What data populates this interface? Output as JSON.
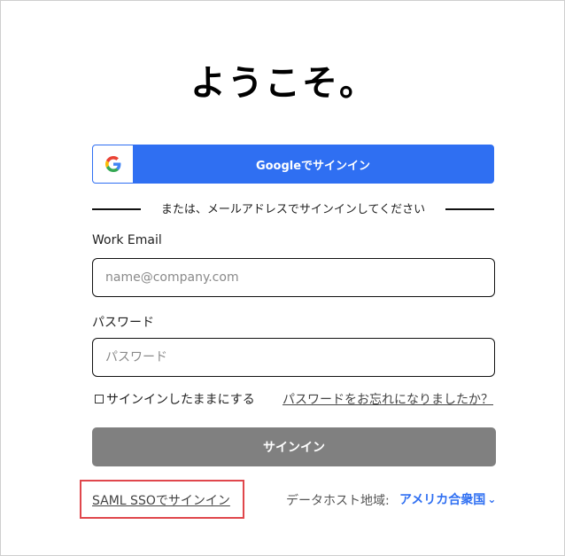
{
  "title": "ようこそ。",
  "google": {
    "button_label": "Googleでサインイン",
    "icon": "google-logo-icon"
  },
  "divider": {
    "text": "または、メールアドレスでサインインしてください"
  },
  "email": {
    "label": "Work Email",
    "placeholder": "name@company.com",
    "value": ""
  },
  "password": {
    "label": "パスワード",
    "placeholder": "パスワード",
    "value": ""
  },
  "remember": {
    "label": "サインインしたままにする",
    "checked": false
  },
  "forgot": {
    "label": "パスワードをお忘れになりましたか？"
  },
  "signin": {
    "label": "サインイン"
  },
  "saml": {
    "label": "SAML SSOでサインイン"
  },
  "region": {
    "label": "データホスト地域:",
    "selected": "アメリカ合衆国",
    "icon": "chevron-down-icon"
  },
  "colors": {
    "primary": "#2f6ff2",
    "disabled_button": "#808080",
    "highlight": "#e0474c"
  }
}
